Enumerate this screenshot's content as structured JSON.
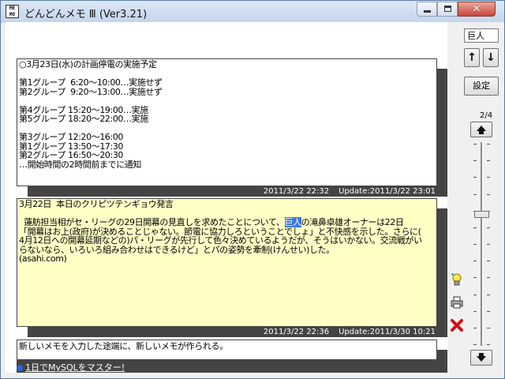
{
  "window": {
    "title": "どんどんメモ Ⅲ (Ver3.21)",
    "app_icon_text": "ME\nMO"
  },
  "memos": [
    {
      "text": "○3月23日(水)の計画停電の実施予定\n\n第1グループ  6:20～10:00…実施せず\n第2グループ  9:20～13:00…実施せず\n\n第4グループ 15:20～19:00…実施\n第5グループ 18:20～22:00…実施\n\n第3グループ 12:20～16:00\n第1グループ 13:50～17:30\n第2グループ 16:50～20:30\n…開始時間の2時間前までに通知",
      "created": "2011/3/22 22:32",
      "updated": "Update:2011/3/22 23:01"
    },
    {
      "text_before": "3月22日  本日のクリピツテンギョウ発言\n\n  蓮舫担当相がセ・リーグの29日開幕の見直しを求めたことについて、",
      "highlight": "巨人",
      "text_after": "の滝鼻卓雄オーナーは22日\n「開幕はお上(政府)が決めることじゃない。節電に協力しろということでしょ」と不快感を示した。さらに(\n4月12日への開幕延期などの)パ・リーグが先行して色々決めているようだが、そうはいかない。交流戦がい\nらないなら、いろいろ組み合わせはできるけど」とパの姿勢を牽制(けんせい)した。\n(asahi.com)",
      "created": "2011/3/22 22:36",
      "updated": "Update:2011/3/30 10:21"
    },
    {
      "text": "新しいメモを入力した途端に、新しいメモが作られる。"
    }
  ],
  "link": {
    "text": "1日でMySQLをマスター!"
  },
  "panel": {
    "search_value": "巨人",
    "up_label": "↑",
    "down_label": "↓",
    "settings_label": "設定",
    "page_counter": "2/4",
    "slider_position": 0.35
  },
  "icons": {
    "scroll_top": "triangle-up-icon",
    "scroll_bottom": "triangle-down-icon",
    "new": "light-bulb-icon",
    "print": "printer-icon",
    "delete": "red-x-icon"
  }
}
